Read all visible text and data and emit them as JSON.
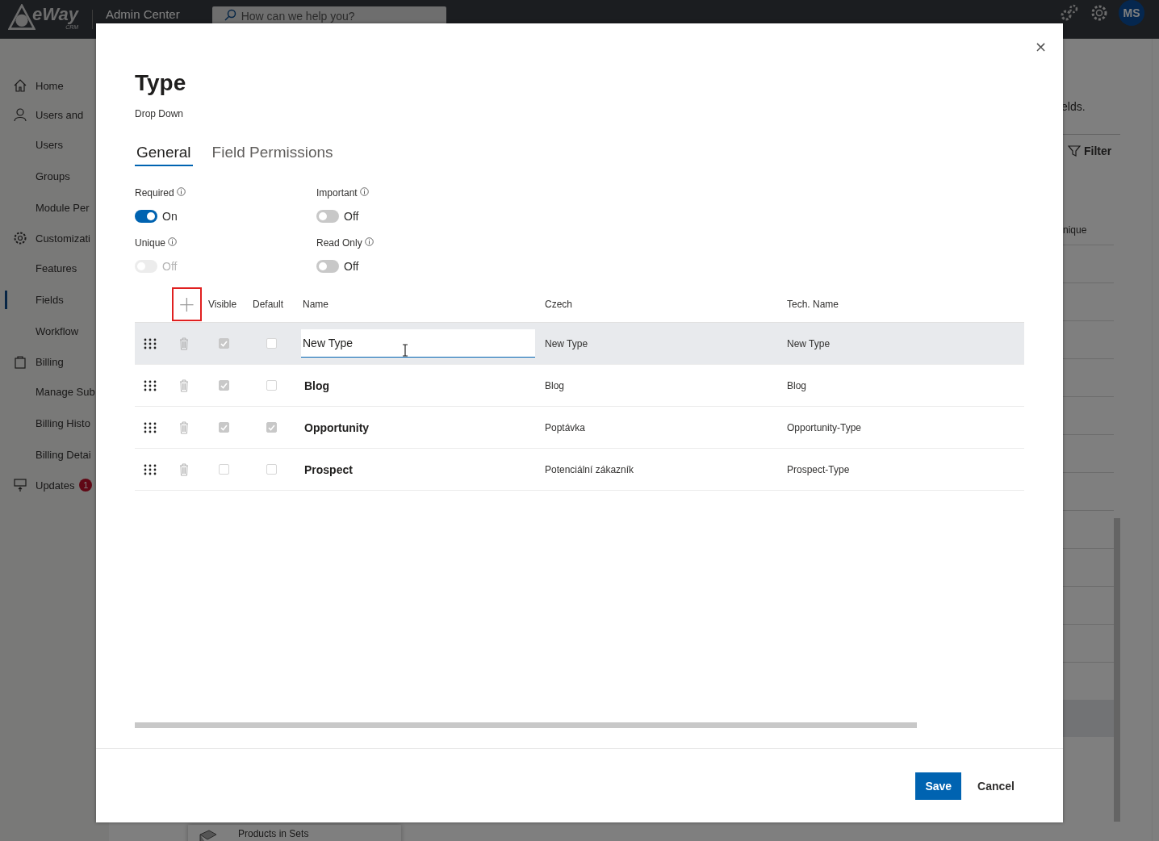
{
  "top_bar": {
    "logo": {
      "name": "eWay",
      "sub": "CRM"
    },
    "title": "Admin Center",
    "search": {
      "placeholder": "How can we help you?"
    },
    "avatar": "MS"
  },
  "sidebar": {
    "items": [
      {
        "label": "Home",
        "selected": false
      },
      {
        "label": "Users and",
        "selected": false,
        "children": [
          {
            "label": "Users",
            "selected": false
          },
          {
            "label": "Groups",
            "selected": false
          },
          {
            "label": "Module Per",
            "selected": false
          }
        ]
      },
      {
        "label": "Customizati",
        "selected": false,
        "children": [
          {
            "label": "Features",
            "selected": false
          },
          {
            "label": "Fields",
            "selected": true
          },
          {
            "label": "Workflow",
            "selected": false
          }
        ]
      },
      {
        "label": "Billing",
        "selected": false,
        "children": [
          {
            "label": "Manage Sub",
            "selected": false
          },
          {
            "label": "Billing Histo",
            "selected": false
          },
          {
            "label": "Billing Detai",
            "selected": false
          }
        ]
      },
      {
        "label": "Updates",
        "selected": false,
        "badge": "1"
      }
    ]
  },
  "background_page": {
    "description_end": "elds.",
    "filter_button": "Filter",
    "column_header_end": "nique",
    "rows": [
      {
        "selected": false
      },
      {
        "selected": false
      },
      {
        "selected": false
      },
      {
        "selected": false
      },
      {
        "selected": false
      },
      {
        "selected": false
      },
      {
        "selected": false
      },
      {
        "selected": false
      },
      {
        "selected": false
      },
      {
        "selected": false
      },
      {
        "selected": false
      },
      {
        "selected": false
      },
      {
        "selected": true
      }
    ],
    "bottom_card": "Products in Sets"
  },
  "dialog": {
    "title": "Type",
    "subtitle": "Drop Down",
    "close": "×",
    "tabs": [
      {
        "label": "General",
        "selected": true
      },
      {
        "label": "Field Permissions",
        "selected": false
      }
    ],
    "settings": [
      {
        "label": "Required",
        "on": true,
        "disabled": false,
        "state_text": "On"
      },
      {
        "label": "Important",
        "on": false,
        "disabled": false,
        "state_text": "Off"
      },
      {
        "label": "Unique",
        "on": false,
        "disabled": true,
        "state_text": "Off"
      },
      {
        "label": "Read Only",
        "on": false,
        "disabled": false,
        "state_text": "Off"
      }
    ],
    "table": {
      "add_button": {
        "label": "+",
        "highlighted": true
      },
      "columns": [
        "Visible",
        "Default",
        "Name",
        "Czech",
        "Tech. Name"
      ],
      "rows": [
        {
          "visible": true,
          "default": false,
          "name": "New Type",
          "czech": "New Type",
          "tech_name": "New Type",
          "selected": true,
          "editing": true
        },
        {
          "visible": true,
          "default": false,
          "name": "Blog",
          "czech": "Blog",
          "tech_name": "Blog",
          "selected": false,
          "editing": false
        },
        {
          "visible": true,
          "default": true,
          "name": "Opportunity",
          "czech": "Poptávka",
          "tech_name": "Opportunity-Type",
          "selected": false,
          "editing": false
        },
        {
          "visible": false,
          "default": false,
          "name": "Prospect",
          "czech": "Potenciální zákazník",
          "tech_name": "Prospect-Type",
          "selected": false,
          "editing": false
        }
      ]
    },
    "buttons": [
      {
        "label": "Save",
        "kind": "primary"
      },
      {
        "label": "Cancel",
        "kind": "plain"
      }
    ]
  }
}
